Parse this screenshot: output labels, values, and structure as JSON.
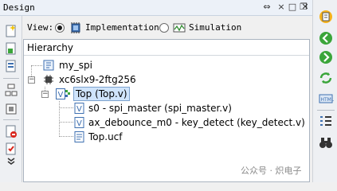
{
  "window": {
    "title": "Design"
  },
  "view": {
    "label": "View:",
    "options": [
      {
        "label": "Implementation",
        "selected": true
      },
      {
        "label": "Simulation",
        "selected": false
      }
    ]
  },
  "hierarchy": {
    "header": "Hierarchy",
    "nodes": [
      {
        "label": "my_spi",
        "icon": "project-icon"
      },
      {
        "label": "xc6slx9-2ftg256",
        "icon": "chip-icon"
      },
      {
        "label": "Top (Top.v)",
        "icon": "top-module-icon",
        "selected": true
      },
      {
        "label": "s0 - spi_master (spi_master.v)",
        "icon": "verilog-file-icon"
      },
      {
        "label": "ax_debounce_m0 - key_detect (key_detect.v)",
        "icon": "verilog-file-icon"
      },
      {
        "label": "Top.ucf",
        "icon": "ucf-file-icon"
      }
    ]
  },
  "colors": {
    "accent": "#2e6fb5",
    "selection": "#cfe4fb",
    "green_nav": "#3aa53a"
  },
  "watermark": "公众号 · 炽电子"
}
